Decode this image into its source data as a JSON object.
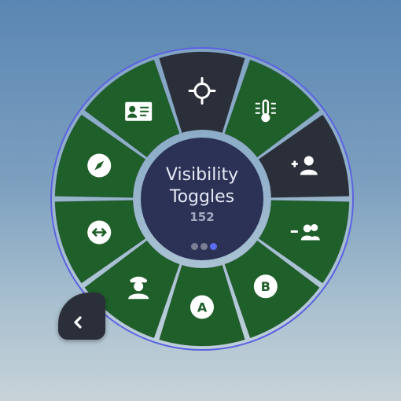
{
  "center": {
    "title_line1": "Visibility",
    "title_line2": "Toggles",
    "count": "152",
    "pager_dots": 3,
    "pager_active": 2
  },
  "colors": {
    "tile_active": "#1f5f2a",
    "tile_inactive": "#2b2f3a",
    "ring": "#5b62e0",
    "center_bg": "#2c3256",
    "dot_active": "#5a6cf0",
    "dot_idle": "#7a7e92"
  },
  "tiles": [
    {
      "name": "crosshair-toggle",
      "icon": "crosshair-icon",
      "state": "inactive"
    },
    {
      "name": "temperature-toggle",
      "icon": "thermometer-icon",
      "state": "active"
    },
    {
      "name": "add-person-toggle",
      "icon": "person-add-icon",
      "state": "inactive"
    },
    {
      "name": "remove-group-toggle",
      "icon": "group-remove-icon",
      "state": "active"
    },
    {
      "name": "label-b-toggle",
      "icon": "letter-b-icon",
      "label": "B",
      "state": "active"
    },
    {
      "name": "label-a-toggle",
      "icon": "letter-a-icon",
      "label": "A",
      "state": "active"
    },
    {
      "name": "pilot-toggle",
      "icon": "pilot-icon",
      "state": "active"
    },
    {
      "name": "distance-toggle",
      "icon": "distance-arrows-icon",
      "state": "active"
    },
    {
      "name": "compass-toggle",
      "icon": "compass-icon",
      "state": "active"
    },
    {
      "name": "id-card-toggle",
      "icon": "id-card-icon",
      "state": "active"
    }
  ],
  "back_button": {
    "icon": "chevron-left-icon"
  }
}
